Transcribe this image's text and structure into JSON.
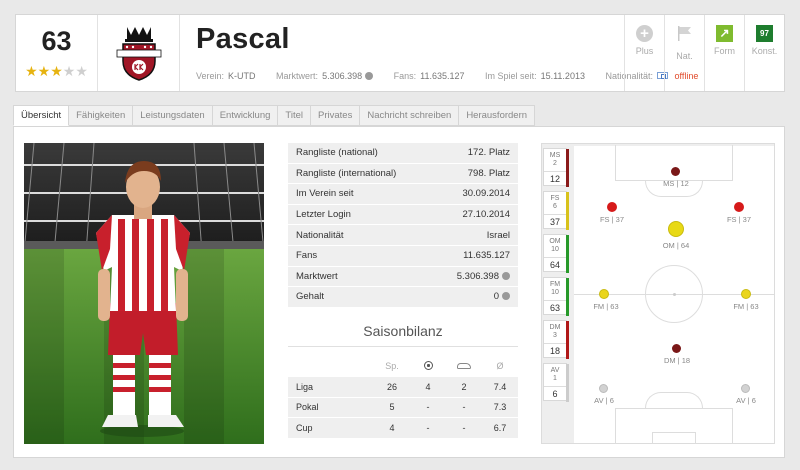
{
  "header": {
    "rating": "63",
    "stars_filled": 3,
    "stars_total": 5,
    "player_name": "Pascal",
    "logo_text": "UNITED KING DOME",
    "meta": {
      "verein_label": "Verein:",
      "verein_value": "K-UTD",
      "marktwert_label": "Marktwert:",
      "marktwert_value": "5.306.398",
      "fans_label": "Fans:",
      "fans_value": "11.635.127",
      "imspiel_label": "Im Spiel seit:",
      "imspiel_value": "15.11.2013",
      "nationalitaet_label": "Nationalität:",
      "status": "offline"
    },
    "actions": [
      {
        "label": "Plus",
        "icon": "plus-icon"
      },
      {
        "label": "Nat.",
        "icon": "flag-icon"
      },
      {
        "label": "Form",
        "icon": "form-arrow-icon"
      },
      {
        "label": "Konst.",
        "icon": "konst-badge",
        "value": "97"
      }
    ],
    "colors": {
      "accent_red": "#a01626",
      "form_green": "#7fbb2f",
      "konst_green": "#1e7d2e",
      "status_red": "#e14a2a"
    }
  },
  "tabs": [
    "Übersicht",
    "Fähigkeiten",
    "Leistungsdaten",
    "Entwicklung",
    "Titel",
    "Privates",
    "Nachricht schreiben",
    "Herausfordern"
  ],
  "info": [
    {
      "label": "Rangliste (national)",
      "value": "172. Platz"
    },
    {
      "label": "Rangliste (international)",
      "value": "798. Platz"
    },
    {
      "label": "Im Verein seit",
      "value": "30.09.2014"
    },
    {
      "label": "Letzter Login",
      "value": "27.10.2014"
    },
    {
      "label": "Nationalität",
      "value": "Israel"
    },
    {
      "label": "Fans",
      "value": "11.635.127"
    },
    {
      "label": "Marktwert",
      "value": "5.306.398"
    },
    {
      "label": "Gehalt",
      "value": "0"
    }
  ],
  "saison": {
    "title": "Saisonbilanz",
    "headers": [
      "Sp.",
      "goals-ball-icon",
      "assists-shoe-icon",
      "Ø"
    ],
    "rows": [
      {
        "name": "Liga",
        "sp": "26",
        "goals": "4",
        "assists": "2",
        "avg": "7.4"
      },
      {
        "name": "Pokal",
        "sp": "5",
        "goals": "-",
        "assists": "-",
        "avg": "7.3"
      },
      {
        "name": "Cup",
        "sp": "4",
        "goals": "-",
        "assists": "-",
        "avg": "6.7"
      }
    ]
  },
  "positions": [
    {
      "abbr": "MS",
      "num": "2",
      "rating": "12",
      "color": "#8a1a1a"
    },
    {
      "abbr": "FS",
      "num": "6",
      "rating": "37",
      "color": "#d8c21c"
    },
    {
      "abbr": "OM",
      "num": "10",
      "rating": "64",
      "color": "#27992a"
    },
    {
      "abbr": "FM",
      "num": "10",
      "rating": "63",
      "color": "#27992a"
    },
    {
      "abbr": "DM",
      "num": "3",
      "rating": "18",
      "color": "#b01818"
    },
    {
      "abbr": "AV",
      "num": "1",
      "rating": "6",
      "color": "#cccccc"
    }
  ],
  "field_labels": {
    "ms": "MS | 12",
    "fs_l": "FS | 37",
    "fs_r": "FS | 37",
    "om": "OM | 64",
    "fm_l": "FM | 63",
    "fm_r": "FM | 63",
    "dm": "DM | 18",
    "av_l": "AV | 6",
    "av_r": "AV | 6"
  }
}
